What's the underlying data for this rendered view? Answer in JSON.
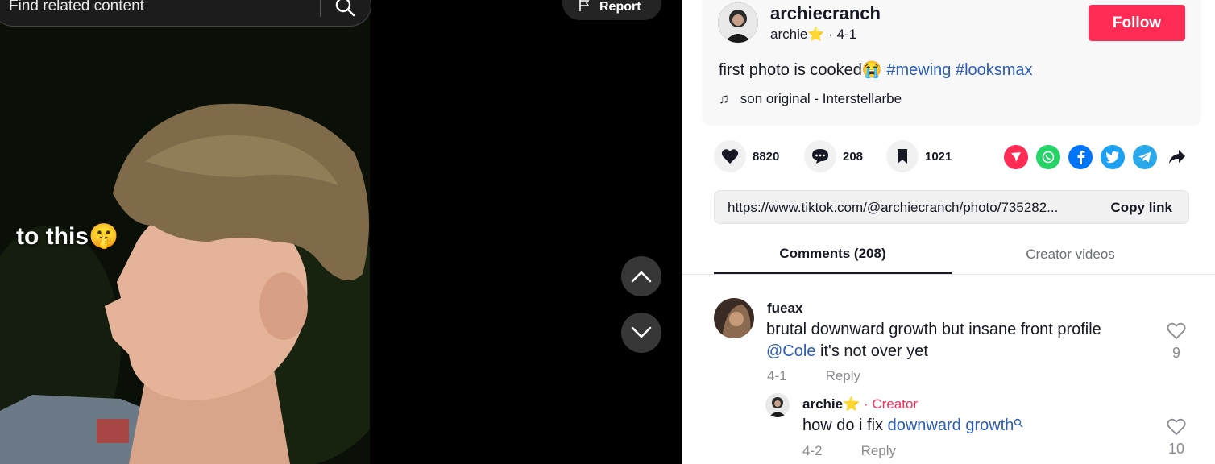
{
  "search": {
    "placeholder": "Find related content",
    "icon": "search-icon"
  },
  "report": {
    "label": "Report",
    "icon": "flag-icon"
  },
  "photo": {
    "overlay_text": "to this🤫"
  },
  "nav": {
    "up_icon": "chevron-up-icon",
    "down_icon": "chevron-down-icon"
  },
  "post": {
    "username": "archiecranch",
    "nickname": "archie⭐",
    "date": "· 4-1",
    "follow_label": "Follow",
    "caption_text": "first photo is cooked😭",
    "hashtags": [
      "#mewing",
      "#looksmax"
    ],
    "music": "son original - Interstellarbe"
  },
  "stats": {
    "likes": "8820",
    "comments": "208",
    "saves": "1021"
  },
  "share_icons": [
    "send-icon",
    "whatsapp-icon",
    "facebook-icon",
    "twitter-icon",
    "telegram-icon",
    "share-arrow-icon"
  ],
  "link": {
    "url": "https://www.tiktok.com/@archiecranch/photo/735282...",
    "copy_label": "Copy link"
  },
  "tabs": {
    "comments": "Comments (208)",
    "creator_videos": "Creator videos"
  },
  "comments": [
    {
      "user": "fueax",
      "text": "brutal downward growth but insane front profile",
      "mention": "@Cole",
      "text_after": " it's not over yet",
      "date": "4-1",
      "reply": "Reply",
      "likes": "9"
    }
  ],
  "reply_comment": {
    "user": "archie⭐",
    "badge": "· Creator",
    "text": "how do i fix ",
    "link_text": "downward growth",
    "date": "4-2",
    "reply": "Reply",
    "likes": "10"
  },
  "colors": {
    "accent": "#fe2c55",
    "link": "#2b5db9",
    "muted": "#8a8b91"
  }
}
